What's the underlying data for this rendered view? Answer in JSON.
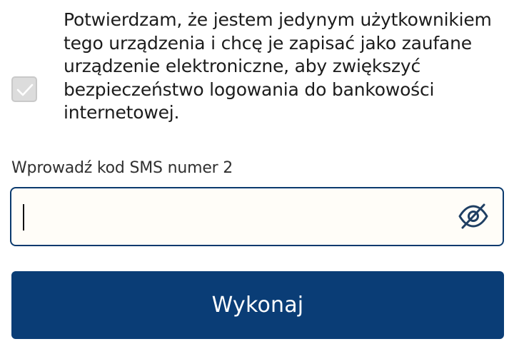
{
  "consent": {
    "checked": true,
    "text": "Potwierdzam, że jestem jedynym użytkownikiem tego urządzenia i chcę je zapisać jako zaufane urządzenie elektroniczne, aby zwiększyć bezpieczeństwo logowania do bankowości internetowej."
  },
  "sms_code": {
    "label": "Wprowadź kod SMS numer 2",
    "value": "",
    "toggle_icon": "eye-off-icon"
  },
  "actions": {
    "submit_label": "Wykonaj"
  },
  "colors": {
    "primary": "#0a3d76",
    "input_border": "#0b3a6e",
    "checkbox_disabled": "#dcdcdc"
  }
}
